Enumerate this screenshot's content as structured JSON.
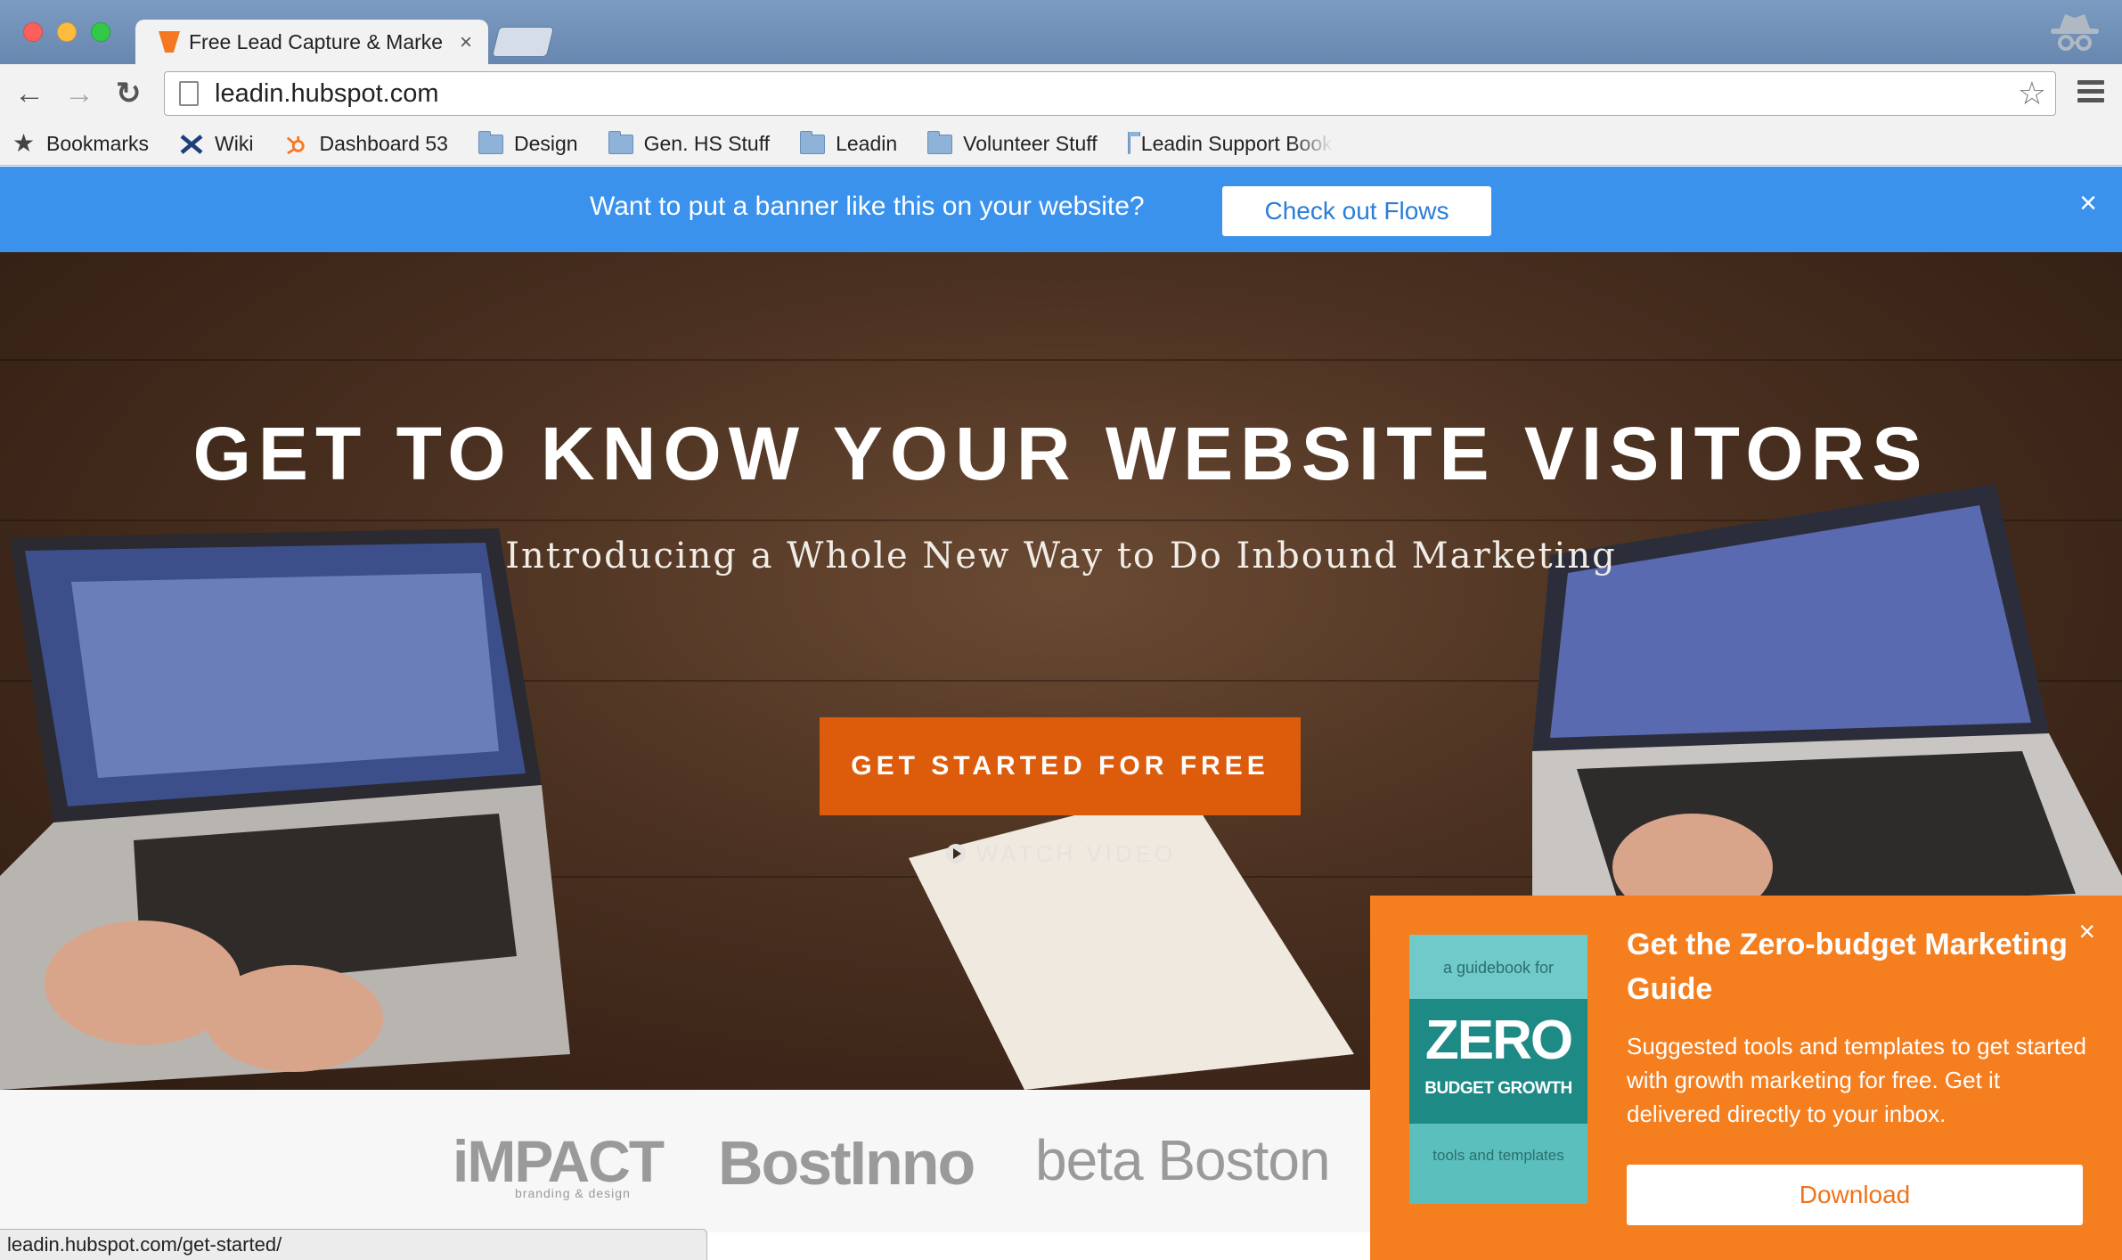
{
  "browser": {
    "tab_title": "Free Lead Capture & Marke",
    "tab_close": "×",
    "url": "leadin.hubspot.com",
    "back": "←",
    "forward": "→",
    "reload": "↻",
    "star": "☆",
    "status_url": "leadin.hubspot.com/get-started/"
  },
  "bookmarks": [
    {
      "label": "Bookmarks",
      "icon": "star-icon"
    },
    {
      "label": "Wiki",
      "icon": "wiki-icon"
    },
    {
      "label": "Dashboard 53",
      "icon": "hubspot-icon"
    },
    {
      "label": "Design",
      "icon": "folder-icon"
    },
    {
      "label": "Gen. HS Stuff",
      "icon": "folder-icon"
    },
    {
      "label": "Leadin",
      "icon": "folder-icon"
    },
    {
      "label": "Volunteer Stuff",
      "icon": "folder-icon"
    },
    {
      "label": "Leadin Support Book",
      "icon": "folder-icon"
    }
  ],
  "flows_banner": {
    "text": "Want to put a banner like this on your website?",
    "button": "Check out Flows",
    "close": "×",
    "color": "#3a92ec"
  },
  "hero": {
    "title": "GET TO KNOW YOUR WEBSITE VISITORS",
    "subtitle": "Introducing a Whole New Way to Do Inbound Marketing",
    "cta": "GET STARTED FOR FREE",
    "watch": "WATCH VIDEO",
    "cta_color": "#dd5c0c"
  },
  "logos": {
    "impact": "iMPACT",
    "impact_tag": "branding & design",
    "bostinno": "BostInno",
    "betaboston": "beta Boston"
  },
  "popup": {
    "book_top": "a guidebook for",
    "book_zero": "ZERO",
    "book_growth": "BUDGET GROWTH",
    "book_bottom": "tools and templates",
    "title": "Get the Zero-budget Marketing Guide",
    "body": "Suggested tools and templates to get started with growth marketing for free. Get it delivered directly to your inbox.",
    "button": "Download",
    "close": "×",
    "color": "#f57e1f"
  }
}
